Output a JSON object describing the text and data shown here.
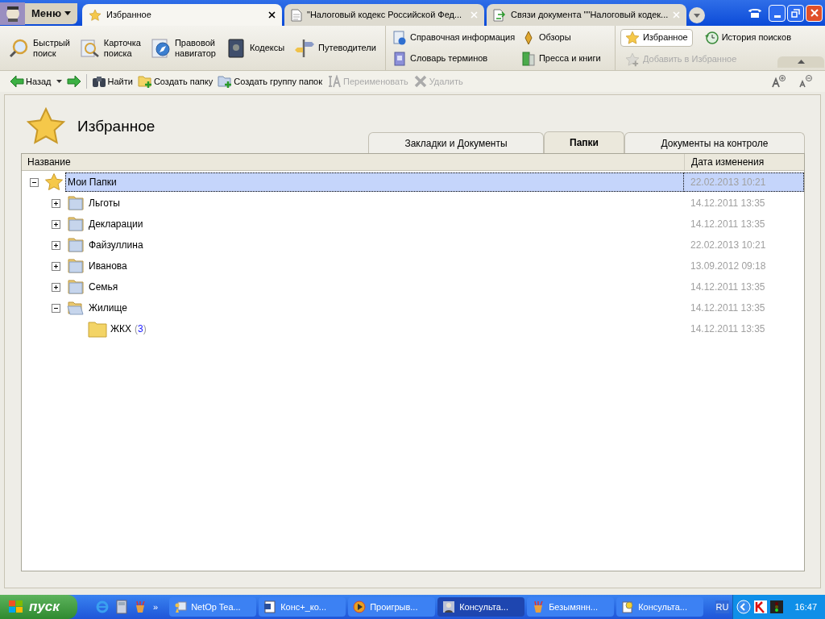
{
  "menu_button": "Меню",
  "doc_tabs": [
    {
      "title": "Избранное",
      "selected": true
    },
    {
      "title": "\"Налоговый кодекс Российской Фед...",
      "selected": false
    },
    {
      "title": "Связи документа \"\"Налоговый кодек...",
      "selected": false
    }
  ],
  "ribbon": {
    "search_group": [
      {
        "label": "Быстрый\nпоиск"
      },
      {
        "label": "Карточка\nпоиска"
      },
      {
        "label": "Правовой\nнавигатор"
      },
      {
        "label": "Кодексы"
      },
      {
        "label": "Путеводители"
      }
    ],
    "info_group": [
      {
        "label": "Справочная информация"
      },
      {
        "label": "Обзоры"
      },
      {
        "label": "Словарь терминов"
      },
      {
        "label": "Пресса и книги"
      }
    ],
    "favorites_group": [
      {
        "label": "Избранное",
        "selected": true,
        "disabled": false
      },
      {
        "label": "История поисков",
        "selected": false,
        "disabled": false
      },
      {
        "label": "Добавить в Избранное",
        "selected": false,
        "disabled": true
      }
    ]
  },
  "toolbar": [
    {
      "label": "Назад",
      "disabled": false
    },
    {
      "label": "Найти",
      "disabled": false
    },
    {
      "label": "Создать папку",
      "disabled": false
    },
    {
      "label": "Создать группу папок",
      "disabled": false
    },
    {
      "label": "Переименовать",
      "disabled": true
    },
    {
      "label": "Удалить",
      "disabled": true
    }
  ],
  "page_title": "Избранное",
  "view_tabs": [
    {
      "label": "Закладки и Документы",
      "selected": false
    },
    {
      "label": "Папки",
      "selected": true
    },
    {
      "label": "Документы на контроле",
      "selected": false
    }
  ],
  "table": {
    "columns": [
      "Название",
      "Дата изменения"
    ],
    "rows": [
      {
        "kind": "favorites",
        "name": "Мои Папки",
        "date": "22.02.2013 10:21",
        "selected": true,
        "expandable": true,
        "expanded": true,
        "children": [
          {
            "kind": "folder",
            "name": "Льготы",
            "date": "14.12.2011 13:35",
            "selected": false,
            "expandable": true,
            "expanded": false
          },
          {
            "kind": "folder",
            "name": "Декларации",
            "date": "14.12.2011 13:35",
            "selected": false,
            "expandable": true,
            "expanded": false
          },
          {
            "kind": "folder",
            "name": "Файзуллина",
            "date": "22.02.2013 10:21",
            "selected": false,
            "expandable": true,
            "expanded": false
          },
          {
            "kind": "folder",
            "name": "Иванова",
            "date": "13.09.2012 09:18",
            "selected": false,
            "expandable": true,
            "expanded": false
          },
          {
            "kind": "folder",
            "name": "Семья",
            "date": "14.12.2011 13:35",
            "selected": false,
            "expandable": true,
            "expanded": false
          },
          {
            "kind": "folder",
            "name": "Жилище",
            "date": "14.12.2011 13:35",
            "selected": false,
            "expandable": true,
            "expanded": true,
            "children": [
              {
                "kind": "folder",
                "name": "ЖКХ",
                "count_open": "(",
                "count": "3",
                "count_close": ")",
                "date": "14.12.2011 13:35",
                "selected": false
              }
            ]
          }
        ]
      }
    ]
  },
  "taskbar": {
    "start": "пуск",
    "quick_launch_more": "»",
    "buttons": [
      {
        "label": "NetOp Tea...",
        "selected": false
      },
      {
        "label": "Конс+_ко...",
        "selected": false
      },
      {
        "label": "Проигрыв...",
        "selected": false
      },
      {
        "label": "Консульта...",
        "selected": true
      },
      {
        "label": "Безымянн...",
        "selected": false
      },
      {
        "label": "Консульта...",
        "selected": false
      }
    ],
    "language": "RU",
    "clock": "16:47"
  }
}
